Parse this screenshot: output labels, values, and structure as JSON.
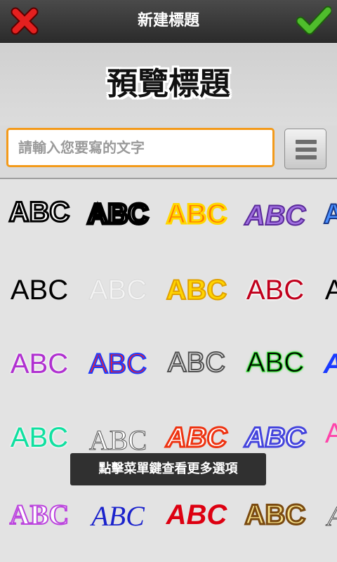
{
  "header": {
    "title": "新建標題",
    "cancel_icon": "close-icon",
    "confirm_icon": "checkmark-icon",
    "cancel_color": "#e5201f",
    "confirm_color": "#4fbd2c"
  },
  "preview": {
    "title": "預覽標題"
  },
  "input": {
    "placeholder": "請輸入您要寫的文字",
    "value": "",
    "accent": "#f39a1a"
  },
  "menu_button_icon": "hamburger-menu-icon",
  "styles": [
    {
      "text": "ABC",
      "color": "#ffffff",
      "stroke": "#000000"
    },
    {
      "text": "ABC",
      "color": "#ffffff",
      "stroke": "#000000"
    },
    {
      "text": "ABC",
      "color": "#ff7a00",
      "stroke": "#ffd700"
    },
    {
      "text": "ABC",
      "color": "#a070e0",
      "stroke": "#5a2a9a"
    },
    {
      "text": "ABC",
      "color": "#4a90ff",
      "stroke": "#1a3a8a"
    },
    {
      "text": "ABC",
      "color": "#000000",
      "stroke": "none"
    },
    {
      "text": "ABC",
      "color": "#f4f4f4",
      "stroke": "#d8d8d8"
    },
    {
      "text": "ABC",
      "color": "#ffd500",
      "stroke": "#e0a000"
    },
    {
      "text": "ABC",
      "color": "#c0001c",
      "stroke": "#ffffff"
    },
    {
      "text": "ABC",
      "color": "#000000",
      "stroke": "#ffffff"
    },
    {
      "text": "ABC",
      "color": "#b030d0",
      "stroke": "#ffffff"
    },
    {
      "text": "ABC",
      "color": "#ff2020",
      "stroke": "#1a3aff"
    },
    {
      "text": "ABC",
      "color": "#e8e8e8",
      "stroke": "#505050"
    },
    {
      "text": "ABC",
      "color": "#000000",
      "stroke": "#22dd22"
    },
    {
      "text": "ABC",
      "color": "#1a3aff",
      "stroke": "#ffffff"
    },
    {
      "text": "ABC",
      "color": "#10e0a0",
      "stroke": "#ffffff"
    },
    {
      "text": "ABC",
      "color": "#ffffff",
      "stroke": "#555555"
    },
    {
      "text": "ABC",
      "color": "#ffffff",
      "stroke": "#ee3311"
    },
    {
      "text": "ABC",
      "color": "#ffffff",
      "stroke": "#4444dd"
    },
    {
      "text": "ABC",
      "color": "#ff44aa",
      "stroke": "#ffffff"
    },
    {
      "text": "ABC",
      "color": "#ffffff",
      "stroke": "#bb44dd"
    },
    {
      "text": "ABC",
      "color": "#1a22cc",
      "stroke": "#ffffff"
    },
    {
      "text": "ABC",
      "color": "#dd0011",
      "stroke": "#ffffff"
    },
    {
      "text": "ABC",
      "color": "#f6e08a",
      "stroke": "#7a4a10"
    },
    {
      "text": "ABC",
      "color": "#ffffff",
      "stroke": "#444444"
    }
  ],
  "toast": {
    "text": "點擊菜單鍵查看更多選項"
  }
}
